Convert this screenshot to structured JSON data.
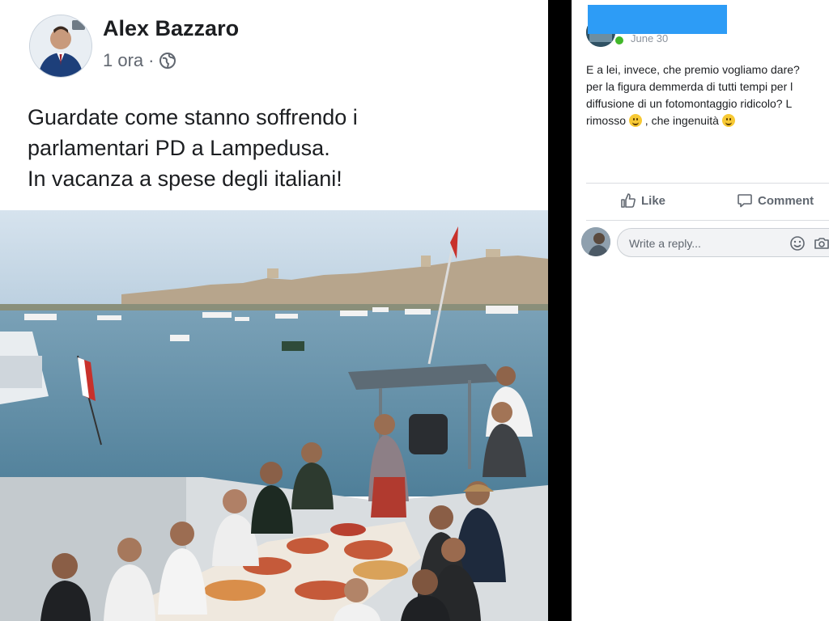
{
  "post": {
    "author": "Alex Bazzaro",
    "time": "1 ora",
    "separator": "·",
    "text_lines": [
      "Guardate come stanno soffrendo i",
      "parlamentari PD a Lampedusa.",
      "In vacanza a spese degli italiani!"
    ],
    "icons": {
      "audience": "globe-icon"
    }
  },
  "comment": {
    "date": "June 30",
    "text_lines": [
      "E a lei, invece, che premio vogliamo dare?",
      "per la figura demmerda di tutti tempi per l",
      "diffusione di un fotomontaggio ridicolo? L",
      "rimosso",
      ", che ingenuità"
    ],
    "emoji": "slightly-smiling-face-icon"
  },
  "actions": {
    "like_label": "Like",
    "comment_label": "Comment"
  },
  "reply": {
    "placeholder": "Write a reply...",
    "icons": [
      "emoji-icon",
      "camera-icon"
    ]
  },
  "colors": {
    "redaction": "#2d9cf6",
    "online": "#42b72a",
    "sea": "#5f8fa8",
    "sky": "#c9dae8"
  }
}
